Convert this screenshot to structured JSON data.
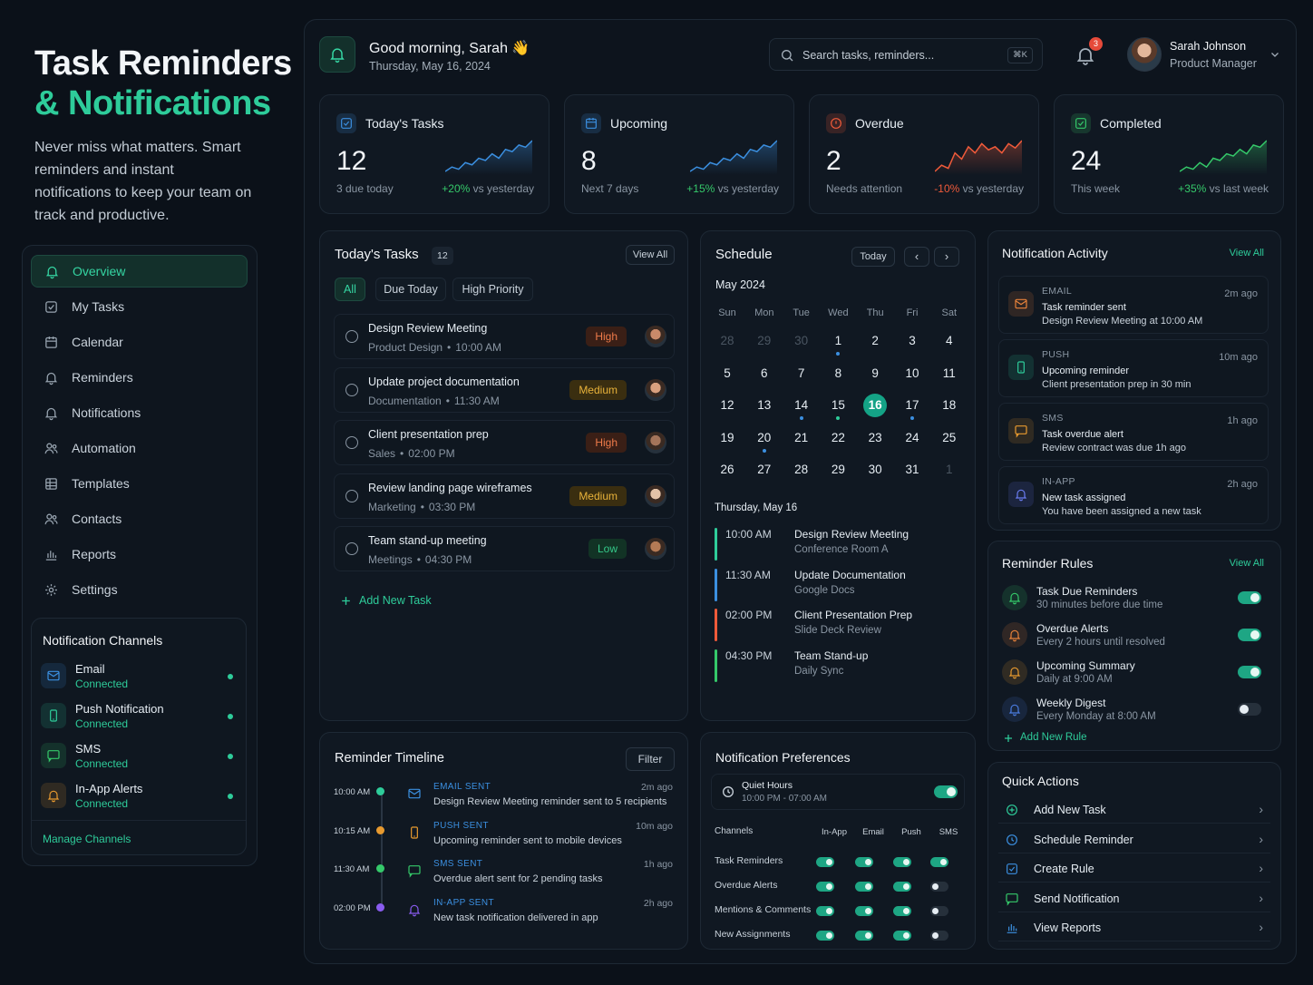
{
  "hero": {
    "title_line1": "Task Reminders",
    "title_line2": "& Notifications",
    "tagline": "Never miss what matters. Smart reminders and instant notifications to keep your team on track and productive."
  },
  "sidebar": {
    "items": [
      {
        "label": "Overview",
        "icon": "bell-icon",
        "active": true
      },
      {
        "label": "My Tasks",
        "icon": "checkbox-icon"
      },
      {
        "label": "Calendar",
        "icon": "calendar-icon"
      },
      {
        "label": "Reminders",
        "icon": "bell-icon"
      },
      {
        "label": "Notifications",
        "icon": "bell-icon"
      },
      {
        "label": "Automation",
        "icon": "users-icon"
      },
      {
        "label": "Templates",
        "icon": "grid-icon"
      },
      {
        "label": "Contacts",
        "icon": "users-icon"
      },
      {
        "label": "Reports",
        "icon": "bar-chart-icon"
      },
      {
        "label": "Settings",
        "icon": "gear-icon"
      }
    ],
    "channels_title": "Notification Channels",
    "channels": [
      {
        "name": "Email",
        "status": "Connected",
        "icon": "mail-icon",
        "color": "#3b8fe0"
      },
      {
        "name": "Push Notification",
        "status": "Connected",
        "icon": "phone-icon",
        "color": "#2ecc9a"
      },
      {
        "name": "SMS",
        "status": "Connected",
        "icon": "message-icon",
        "color": "#35c96a"
      },
      {
        "name": "In-App Alerts",
        "status": "Connected",
        "icon": "bell-icon",
        "color": "#e89a2f"
      }
    ],
    "manage_label": "Manage Channels"
  },
  "header": {
    "greeting": "Good morning, Sarah 👋",
    "date": "Thursday, May 16, 2024",
    "search_placeholder": "Search tasks, reminders...",
    "search_shortcut": "⌘K",
    "notif_count": "3",
    "user_name": "Sarah Johnson",
    "user_role": "Product Manager"
  },
  "stats": [
    {
      "label": "Today's Tasks",
      "value": "12",
      "sub": "3 due today",
      "change": "+20%",
      "change_text": " vs yesterday",
      "color": "#3b8fe0",
      "up": true,
      "trend": [
        3,
        4,
        3.5,
        5,
        4.5,
        6,
        5.5,
        7,
        6,
        8,
        7.5,
        9,
        8.5,
        10
      ]
    },
    {
      "label": "Upcoming",
      "value": "8",
      "sub": "Next 7 days",
      "change": "+15%",
      "change_text": " vs yesterday",
      "color": "#3b8fe0",
      "up": true,
      "trend": [
        2,
        3,
        2.5,
        4,
        3.5,
        5,
        4.5,
        6,
        5,
        7,
        6.5,
        8,
        7.5,
        9
      ]
    },
    {
      "label": "Overdue",
      "value": "2",
      "sub": "Needs attention",
      "change": "-10%",
      "change_text": " vs yesterday",
      "color": "#ef5a3a",
      "up": false,
      "trend": [
        3,
        4,
        3.5,
        6,
        5,
        7,
        6,
        7.5,
        6.5,
        7,
        6,
        7.5,
        6.8,
        8
      ]
    },
    {
      "label": "Completed",
      "value": "24",
      "sub": "This week",
      "change": "+35%",
      "change_text": " vs last week",
      "color": "#35c96a",
      "up": true,
      "trend": [
        2,
        3,
        2.5,
        4,
        3,
        5,
        4.5,
        6,
        5.5,
        7,
        6,
        8,
        7.5,
        9
      ]
    }
  ],
  "tasks": {
    "title": "Today's Tasks",
    "count": "12",
    "view_all": "View All",
    "filters": [
      "All",
      "Due Today",
      "High Priority"
    ],
    "items": [
      {
        "title": "Design Review Meeting",
        "category": "Product Design",
        "time": "10:00 AM",
        "priority": "High",
        "level": "high"
      },
      {
        "title": "Update project documentation",
        "category": "Documentation",
        "time": "11:30 AM",
        "priority": "Medium",
        "level": "medium"
      },
      {
        "title": "Client presentation prep",
        "category": "Sales",
        "time": "02:00 PM",
        "priority": "High",
        "level": "high"
      },
      {
        "title": "Review landing page wireframes",
        "category": "Marketing",
        "time": "03:30 PM",
        "priority": "Medium",
        "level": "medium"
      },
      {
        "title": "Team stand-up meeting",
        "category": "Meetings",
        "time": "04:30 PM",
        "priority": "Low",
        "level": "low"
      }
    ],
    "add_label": "Add New Task"
  },
  "schedule": {
    "title": "Schedule",
    "today_label": "Today",
    "month": "May 2024",
    "weekdays": [
      "Sun",
      "Mon",
      "Tue",
      "Wed",
      "Thu",
      "Fri",
      "Sat"
    ],
    "days": [
      "28",
      "29",
      "30",
      "1",
      "2",
      "3",
      "4",
      "5",
      "6",
      "7",
      "8",
      "9",
      "10",
      "11",
      "12",
      "13",
      "14",
      "15",
      "16",
      "17",
      "18",
      "19",
      "20",
      "21",
      "22",
      "23",
      "24",
      "25",
      "26",
      "27",
      "28",
      "29",
      "30",
      "31",
      "1"
    ],
    "day_label": "Thursday, May 16",
    "events": [
      {
        "time": "10:00 AM",
        "title": "Design Review Meeting",
        "location": "Conference Room A",
        "color": "#2ecc9a"
      },
      {
        "time": "11:30 AM",
        "title": "Update Documentation",
        "location": "Google Docs",
        "color": "#3b8fe0"
      },
      {
        "time": "02:00 PM",
        "title": "Client Presentation Prep",
        "location": "Slide Deck Review",
        "color": "#ef5a3a"
      },
      {
        "time": "04:30 PM",
        "title": "Team Stand-up",
        "location": "Daily Sync",
        "color": "#35c96a"
      }
    ]
  },
  "activity": {
    "title": "Notification Activity",
    "view_all": "View All",
    "items": [
      {
        "kind": "EMAIL",
        "line1": "Task reminder sent",
        "line2": "Design Review Meeting at 10:00 AM",
        "ago": "2m ago",
        "icon": "mail-icon",
        "color": "#e8823a"
      },
      {
        "kind": "PUSH",
        "line1": "Upcoming reminder",
        "line2": "Client presentation prep in 30 min",
        "ago": "10m ago",
        "icon": "phone-icon",
        "color": "#2ecc9a"
      },
      {
        "kind": "SMS",
        "line1": "Task overdue alert",
        "line2": "Review contract was due 1h ago",
        "ago": "1h ago",
        "icon": "message-icon",
        "color": "#e89a2f"
      },
      {
        "kind": "IN-APP",
        "line1": "New task assigned",
        "line2": "You have been assigned a new task",
        "ago": "2h ago",
        "icon": "bell-icon",
        "color": "#6a7cf0"
      }
    ]
  },
  "rules": {
    "title": "Reminder Rules",
    "view_all": "View All",
    "items": [
      {
        "title": "Task Due Reminders",
        "sub": "30 minutes before due time",
        "on": true,
        "color": "#35c96a"
      },
      {
        "title": "Overdue Alerts",
        "sub": "Every 2 hours until resolved",
        "on": true,
        "color": "#e8823a"
      },
      {
        "title": "Upcoming Summary",
        "sub": "Daily at 9:00 AM",
        "on": true,
        "color": "#e89a2f"
      },
      {
        "title": "Weekly Digest",
        "sub": "Every Monday at 8:00 AM",
        "on": false,
        "color": "#4a7ce0"
      }
    ],
    "add_label": "Add New Rule"
  },
  "timeline": {
    "title": "Reminder Timeline",
    "filter_label": "Filter",
    "items": [
      {
        "time": "10:00 AM",
        "kind": "EMAIL SENT",
        "desc": "Design Review Meeting reminder sent to 5 recipients",
        "ago": "2m ago",
        "color": "#2ecc9a",
        "kcolor": "#3b8fe0",
        "icon": "mail-icon"
      },
      {
        "time": "10:15 AM",
        "kind": "PUSH SENT",
        "desc": "Upcoming reminder sent to mobile devices",
        "ago": "10m ago",
        "color": "#e89a2f",
        "kcolor": "#3b8fe0",
        "icon": "phone-icon"
      },
      {
        "time": "11:30 AM",
        "kind": "SMS SENT",
        "desc": "Overdue alert sent for 2 pending tasks",
        "ago": "1h ago",
        "color": "#35c96a",
        "kcolor": "#3b8fe0",
        "icon": "message-icon"
      },
      {
        "time": "02:00 PM",
        "kind": "IN-APP SENT",
        "desc": "New task notification delivered in app",
        "ago": "2h ago",
        "color": "#8a5cf0",
        "kcolor": "#3b8fe0",
        "icon": "bell-icon"
      }
    ]
  },
  "prefs": {
    "title": "Notification Preferences",
    "quiet_title": "Quiet Hours",
    "quiet_time": "10:00 PM - 07:00 AM",
    "quiet_on": true,
    "channels_label": "Channels",
    "columns": [
      "In-App",
      "Email",
      "Push",
      "SMS"
    ],
    "rows": [
      {
        "label": "Task Reminders",
        "values": [
          true,
          true,
          true,
          true
        ]
      },
      {
        "label": "Overdue Alerts",
        "values": [
          true,
          true,
          true,
          false
        ]
      },
      {
        "label": "Mentions & Comments",
        "values": [
          true,
          true,
          true,
          false
        ]
      },
      {
        "label": "New Assignments",
        "values": [
          true,
          true,
          true,
          false
        ]
      }
    ]
  },
  "quick": {
    "title": "Quick Actions",
    "items": [
      {
        "label": "Add New Task",
        "icon": "plus-circle-icon",
        "color": "#2ecc9a"
      },
      {
        "label": "Schedule Reminder",
        "icon": "clock-icon",
        "color": "#3b8fe0"
      },
      {
        "label": "Create Rule",
        "icon": "checkbox-icon",
        "color": "#3b8fe0"
      },
      {
        "label": "Send Notification",
        "icon": "message-icon",
        "color": "#35c96a"
      },
      {
        "label": "View Reports",
        "icon": "bar-chart-icon",
        "color": "#3b8fe0"
      }
    ]
  }
}
